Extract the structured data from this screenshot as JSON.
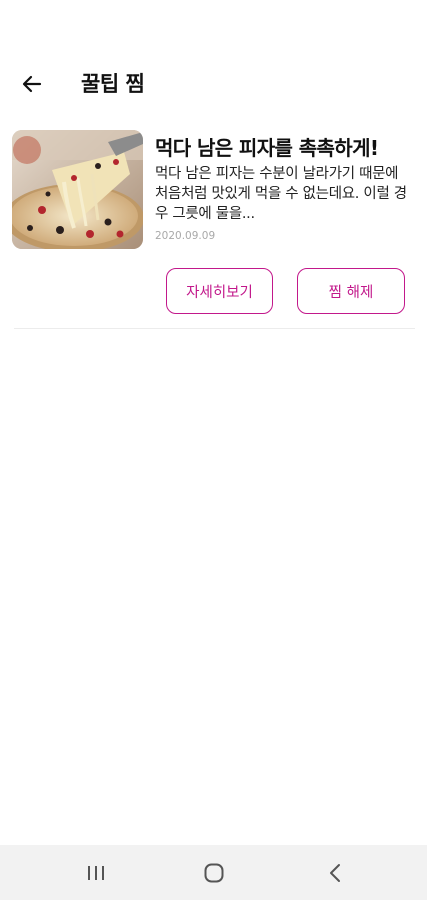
{
  "header": {
    "title": "꿀팁 찜",
    "back_icon": "arrow-left-icon"
  },
  "tip_card": {
    "title": "먹다 남은 피자를 촉촉하게!",
    "body": "먹다 남은 피자는 수분이 날라가기 때문에 처음처럼 맛있게 먹을 수 없는데요. 이럴 경우 그릇에 물을...",
    "date": "2020.09.09",
    "image": "pizza-slice-cheese-pull-photo",
    "detail_button": "자세히보기",
    "unfavorite_button": "찜 해제"
  },
  "navbar": {
    "recent_icon": "recent-apps-icon",
    "home_icon": "home-icon",
    "back_icon": "back-chevron-icon"
  },
  "colors": {
    "accent": "#c2188b",
    "date_text": "#a9a9a9",
    "divider": "#ececec",
    "navbar_bg": "#f2f2f2"
  }
}
